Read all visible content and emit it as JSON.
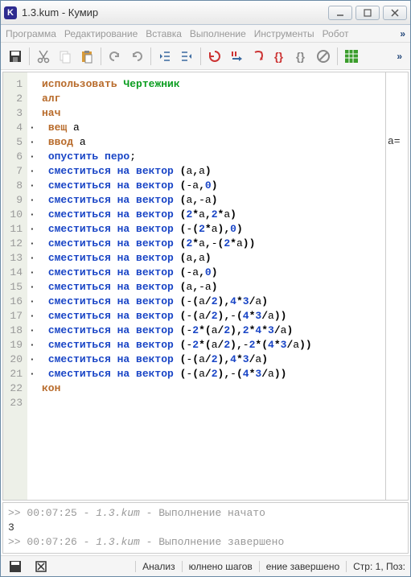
{
  "window": {
    "icon_letter": "K",
    "title": "1.3.kum - Кумир"
  },
  "menu": {
    "program": "Программа",
    "edit": "Редактирование",
    "insert": "Вставка",
    "run": "Выполнение",
    "tools": "Инструменты",
    "robot": "Робот",
    "more": "»"
  },
  "toolbar_more": "»",
  "side_text": "a=",
  "code_lines": [
    {
      "n": 1,
      "m": "",
      "t": [
        [
          "kw",
          "использовать"
        ],
        [
          "plain",
          " "
        ],
        [
          "lib",
          "Чертежник"
        ]
      ]
    },
    {
      "n": 2,
      "m": "",
      "t": [
        [
          "kw",
          "алг"
        ]
      ]
    },
    {
      "n": 3,
      "m": "",
      "t": [
        [
          "kw",
          "нач"
        ]
      ]
    },
    {
      "n": 4,
      "m": "·",
      "t": [
        [
          "plain",
          " "
        ],
        [
          "kw",
          "вещ"
        ],
        [
          "plain",
          " a"
        ]
      ]
    },
    {
      "n": 5,
      "m": "·",
      "t": [
        [
          "plain",
          " "
        ],
        [
          "kw",
          "ввод"
        ],
        [
          "plain",
          " a"
        ]
      ]
    },
    {
      "n": 6,
      "m": "·",
      "t": [
        [
          "plain",
          " "
        ],
        [
          "cmd",
          "опустить перо"
        ],
        [
          "plain",
          ";"
        ]
      ]
    },
    {
      "n": 7,
      "m": "·",
      "t": [
        [
          "plain",
          " "
        ],
        [
          "cmd",
          "сместиться на вектор"
        ],
        [
          "plain",
          " "
        ],
        [
          "sym",
          "("
        ],
        [
          "plain",
          "a"
        ],
        [
          "sym",
          ","
        ],
        [
          "plain",
          "a"
        ],
        [
          "sym",
          ")"
        ]
      ]
    },
    {
      "n": 8,
      "m": "·",
      "t": [
        [
          "plain",
          " "
        ],
        [
          "cmd",
          "сместиться на вектор"
        ],
        [
          "plain",
          " "
        ],
        [
          "sym",
          "("
        ],
        [
          "plain",
          "-a"
        ],
        [
          "sym",
          ","
        ],
        [
          "num",
          "0"
        ],
        [
          "sym",
          ")"
        ]
      ]
    },
    {
      "n": 9,
      "m": "·",
      "t": [
        [
          "plain",
          " "
        ],
        [
          "cmd",
          "сместиться на вектор"
        ],
        [
          "plain",
          " "
        ],
        [
          "sym",
          "("
        ],
        [
          "plain",
          "a"
        ],
        [
          "sym",
          ","
        ],
        [
          "plain",
          "-a"
        ],
        [
          "sym",
          ")"
        ]
      ]
    },
    {
      "n": 10,
      "m": "·",
      "t": [
        [
          "plain",
          " "
        ],
        [
          "cmd",
          "сместиться на вектор"
        ],
        [
          "plain",
          " "
        ],
        [
          "sym",
          "("
        ],
        [
          "num",
          "2"
        ],
        [
          "sym",
          "*"
        ],
        [
          "plain",
          "a"
        ],
        [
          "sym",
          ","
        ],
        [
          "num",
          "2"
        ],
        [
          "sym",
          "*"
        ],
        [
          "plain",
          "a"
        ],
        [
          "sym",
          ")"
        ]
      ]
    },
    {
      "n": 11,
      "m": "·",
      "t": [
        [
          "plain",
          " "
        ],
        [
          "cmd",
          "сместиться на вектор"
        ],
        [
          "plain",
          " "
        ],
        [
          "sym",
          "("
        ],
        [
          "plain",
          "-"
        ],
        [
          "sym",
          "("
        ],
        [
          "num",
          "2"
        ],
        [
          "sym",
          "*"
        ],
        [
          "plain",
          "a"
        ],
        [
          "sym",
          ")"
        ],
        [
          "sym",
          ","
        ],
        [
          "num",
          "0"
        ],
        [
          "sym",
          ")"
        ]
      ]
    },
    {
      "n": 12,
      "m": "·",
      "t": [
        [
          "plain",
          " "
        ],
        [
          "cmd",
          "сместиться на вектор"
        ],
        [
          "plain",
          " "
        ],
        [
          "sym",
          "("
        ],
        [
          "num",
          "2"
        ],
        [
          "sym",
          "*"
        ],
        [
          "plain",
          "a"
        ],
        [
          "sym",
          ","
        ],
        [
          "plain",
          "-"
        ],
        [
          "sym",
          "("
        ],
        [
          "num",
          "2"
        ],
        [
          "sym",
          "*"
        ],
        [
          "plain",
          "a"
        ],
        [
          "sym",
          "))"
        ]
      ]
    },
    {
      "n": 13,
      "m": "·",
      "t": [
        [
          "plain",
          " "
        ],
        [
          "cmd",
          "сместиться на вектор"
        ],
        [
          "plain",
          " "
        ],
        [
          "sym",
          "("
        ],
        [
          "plain",
          "a"
        ],
        [
          "sym",
          ","
        ],
        [
          "plain",
          "a"
        ],
        [
          "sym",
          ")"
        ]
      ]
    },
    {
      "n": 14,
      "m": "·",
      "t": [
        [
          "plain",
          " "
        ],
        [
          "cmd",
          "сместиться на вектор"
        ],
        [
          "plain",
          " "
        ],
        [
          "sym",
          "("
        ],
        [
          "plain",
          "-a"
        ],
        [
          "sym",
          ","
        ],
        [
          "num",
          "0"
        ],
        [
          "sym",
          ")"
        ]
      ]
    },
    {
      "n": 15,
      "m": "·",
      "t": [
        [
          "plain",
          " "
        ],
        [
          "cmd",
          "сместиться на вектор"
        ],
        [
          "plain",
          " "
        ],
        [
          "sym",
          "("
        ],
        [
          "plain",
          "a"
        ],
        [
          "sym",
          ","
        ],
        [
          "plain",
          "-a"
        ],
        [
          "sym",
          ")"
        ]
      ]
    },
    {
      "n": 16,
      "m": "·",
      "t": [
        [
          "plain",
          " "
        ],
        [
          "cmd",
          "сместиться на вектор"
        ],
        [
          "plain",
          " "
        ],
        [
          "sym",
          "("
        ],
        [
          "plain",
          "-"
        ],
        [
          "sym",
          "("
        ],
        [
          "plain",
          "a"
        ],
        [
          "sym",
          "/"
        ],
        [
          "num",
          "2"
        ],
        [
          "sym",
          ")"
        ],
        [
          "sym",
          ","
        ],
        [
          "num",
          "4"
        ],
        [
          "sym",
          "*"
        ],
        [
          "num",
          "3"
        ],
        [
          "sym",
          "/"
        ],
        [
          "plain",
          "a"
        ],
        [
          "sym",
          ")"
        ]
      ]
    },
    {
      "n": 17,
      "m": "·",
      "t": [
        [
          "plain",
          " "
        ],
        [
          "cmd",
          "сместиться на вектор"
        ],
        [
          "plain",
          " "
        ],
        [
          "sym",
          "("
        ],
        [
          "plain",
          "-"
        ],
        [
          "sym",
          "("
        ],
        [
          "plain",
          "a"
        ],
        [
          "sym",
          "/"
        ],
        [
          "num",
          "2"
        ],
        [
          "sym",
          ")"
        ],
        [
          "sym",
          ","
        ],
        [
          "plain",
          "-"
        ],
        [
          "sym",
          "("
        ],
        [
          "num",
          "4"
        ],
        [
          "sym",
          "*"
        ],
        [
          "num",
          "3"
        ],
        [
          "sym",
          "/"
        ],
        [
          "plain",
          "a"
        ],
        [
          "sym",
          "))"
        ]
      ]
    },
    {
      "n": 18,
      "m": "·",
      "t": [
        [
          "plain",
          " "
        ],
        [
          "cmd",
          "сместиться на вектор"
        ],
        [
          "plain",
          " "
        ],
        [
          "sym",
          "("
        ],
        [
          "plain",
          "-"
        ],
        [
          "num",
          "2"
        ],
        [
          "sym",
          "*("
        ],
        [
          "plain",
          "a"
        ],
        [
          "sym",
          "/"
        ],
        [
          "num",
          "2"
        ],
        [
          "sym",
          ")"
        ],
        [
          "sym",
          ","
        ],
        [
          "num",
          "2"
        ],
        [
          "sym",
          "*"
        ],
        [
          "num",
          "4"
        ],
        [
          "sym",
          "*"
        ],
        [
          "num",
          "3"
        ],
        [
          "sym",
          "/"
        ],
        [
          "plain",
          "a"
        ],
        [
          "sym",
          ")"
        ]
      ]
    },
    {
      "n": 19,
      "m": "·",
      "t": [
        [
          "plain",
          " "
        ],
        [
          "cmd",
          "сместиться на вектор"
        ],
        [
          "plain",
          " "
        ],
        [
          "sym",
          "("
        ],
        [
          "plain",
          "-"
        ],
        [
          "num",
          "2"
        ],
        [
          "sym",
          "*("
        ],
        [
          "plain",
          "a"
        ],
        [
          "sym",
          "/"
        ],
        [
          "num",
          "2"
        ],
        [
          "sym",
          ")"
        ],
        [
          "sym",
          ","
        ],
        [
          "plain",
          "-"
        ],
        [
          "num",
          "2"
        ],
        [
          "sym",
          "*("
        ],
        [
          "num",
          "4"
        ],
        [
          "sym",
          "*"
        ],
        [
          "num",
          "3"
        ],
        [
          "sym",
          "/"
        ],
        [
          "plain",
          "a"
        ],
        [
          "sym",
          "))"
        ]
      ]
    },
    {
      "n": 20,
      "m": "·",
      "t": [
        [
          "plain",
          " "
        ],
        [
          "cmd",
          "сместиться на вектор"
        ],
        [
          "plain",
          " "
        ],
        [
          "sym",
          "("
        ],
        [
          "plain",
          "-"
        ],
        [
          "sym",
          "("
        ],
        [
          "plain",
          "a"
        ],
        [
          "sym",
          "/"
        ],
        [
          "num",
          "2"
        ],
        [
          "sym",
          ")"
        ],
        [
          "sym",
          ","
        ],
        [
          "num",
          "4"
        ],
        [
          "sym",
          "*"
        ],
        [
          "num",
          "3"
        ],
        [
          "sym",
          "/"
        ],
        [
          "plain",
          "a"
        ],
        [
          "sym",
          ")"
        ]
      ]
    },
    {
      "n": 21,
      "m": "·",
      "t": [
        [
          "plain",
          " "
        ],
        [
          "cmd",
          "сместиться на вектор"
        ],
        [
          "plain",
          " "
        ],
        [
          "sym",
          "("
        ],
        [
          "plain",
          "-"
        ],
        [
          "sym",
          "("
        ],
        [
          "plain",
          "a"
        ],
        [
          "sym",
          "/"
        ],
        [
          "num",
          "2"
        ],
        [
          "sym",
          ")"
        ],
        [
          "sym",
          ","
        ],
        [
          "plain",
          "-"
        ],
        [
          "sym",
          "("
        ],
        [
          "num",
          "4"
        ],
        [
          "sym",
          "*"
        ],
        [
          "num",
          "3"
        ],
        [
          "sym",
          "/"
        ],
        [
          "plain",
          "a"
        ],
        [
          "sym",
          "))"
        ]
      ]
    },
    {
      "n": 22,
      "m": "",
      "t": [
        [
          "kw",
          "кон"
        ]
      ]
    },
    {
      "n": 23,
      "m": "",
      "t": [
        [
          "plain",
          ""
        ]
      ]
    }
  ],
  "console": {
    "l1_prefix": ">> ",
    "l1_time": "00:07:25",
    "l1_sep": " - ",
    "l1_file": "1.3.kum",
    "l1_msg": " - Выполнение начато",
    "l2": "3",
    "l3_prefix": ">> ",
    "l3_time": "00:07:26",
    "l3_sep": " - ",
    "l3_file": "1.3.kum",
    "l3_msg": " - Выполнение завершено"
  },
  "status": {
    "analyze": "Анализ",
    "steps": "юлнено шагов",
    "done": "ение завершено",
    "pos": "Стр: 1, Поз:"
  }
}
